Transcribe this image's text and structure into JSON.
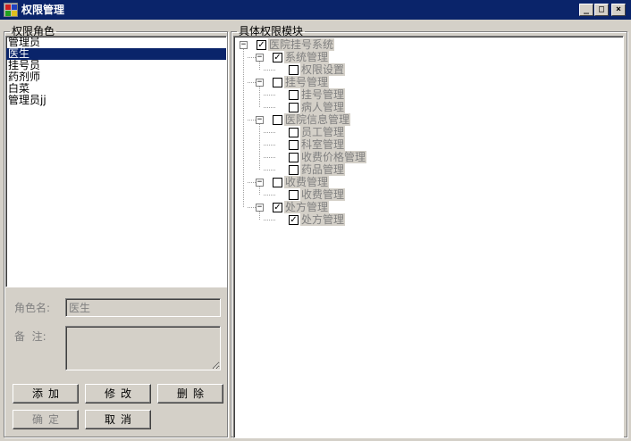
{
  "window": {
    "title": "权限管理",
    "min_glyph": "_",
    "max_glyph": "□",
    "close_glyph": "×"
  },
  "roles_panel": {
    "title": "权限角色",
    "items": [
      "管理员",
      "医生",
      "挂号员",
      "药剂师",
      "白菜",
      "管理员jj"
    ],
    "selected_index": 1,
    "role_name_label": "角色名:",
    "role_name_value": "医生",
    "note_label": "备  注:",
    "note_value": "",
    "buttons": {
      "add": "添加",
      "edit": "修改",
      "delete": "删除",
      "ok": "确定",
      "cancel": "取消"
    }
  },
  "perm_panel": {
    "title": "具体权限模块",
    "tree": {
      "label": "医院挂号系统",
      "checked": true,
      "expanded": true,
      "children": [
        {
          "label": "系统管理",
          "checked": true,
          "expanded": true,
          "children": [
            {
              "label": "权限设置",
              "checked": false
            }
          ]
        },
        {
          "label": "挂号管理",
          "checked": false,
          "expanded": true,
          "children": [
            {
              "label": "挂号管理",
              "checked": false
            },
            {
              "label": "病人管理",
              "checked": false
            }
          ]
        },
        {
          "label": "医院信息管理",
          "checked": false,
          "expanded": true,
          "children": [
            {
              "label": "员工管理",
              "checked": false
            },
            {
              "label": "科室管理",
              "checked": false
            },
            {
              "label": "收费价格管理",
              "checked": false
            },
            {
              "label": "药品管理",
              "checked": false
            }
          ]
        },
        {
          "label": "收费管理",
          "checked": false,
          "expanded": true,
          "children": [
            {
              "label": "收费管理",
              "checked": false
            }
          ]
        },
        {
          "label": "处方管理",
          "checked": true,
          "expanded": true,
          "children": [
            {
              "label": "处方管理",
              "checked": true
            }
          ]
        }
      ]
    }
  }
}
